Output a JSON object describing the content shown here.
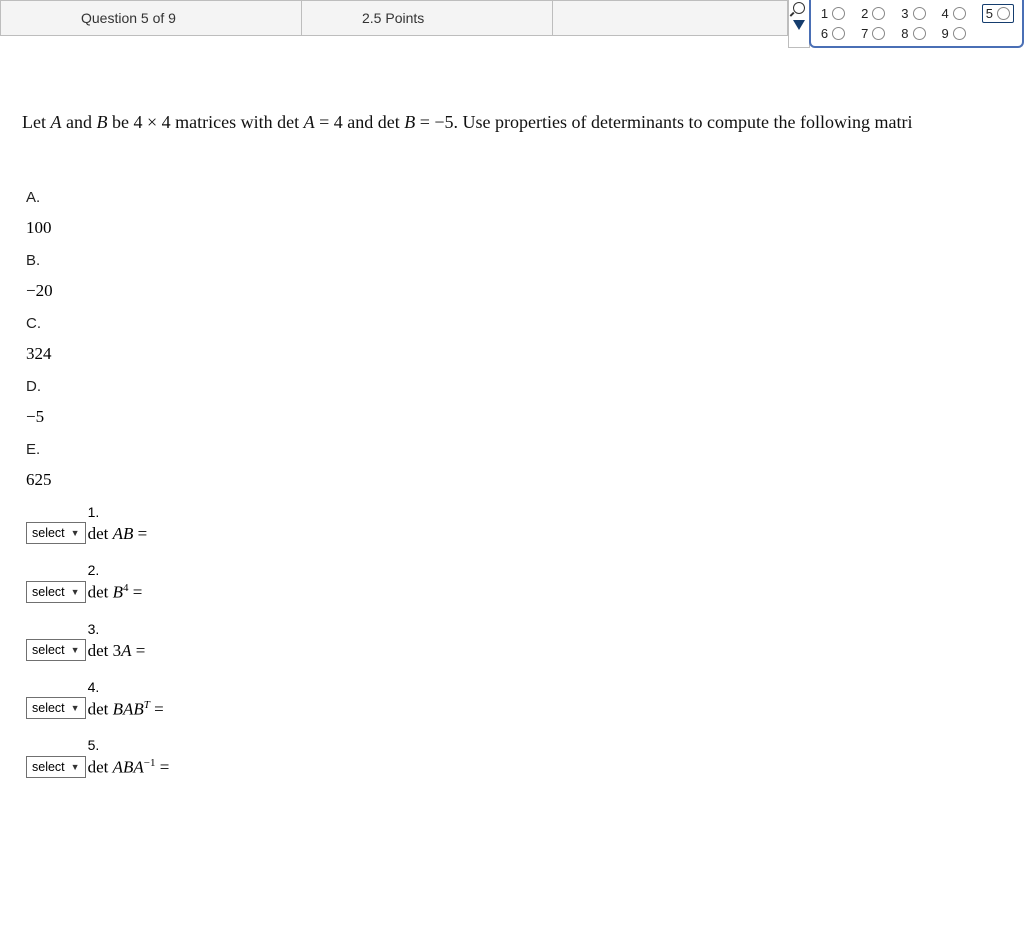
{
  "header": {
    "question_label": "Question 5 of 9",
    "points_label": "2.5 Points"
  },
  "nav": {
    "row1": [
      "1",
      "2",
      "3",
      "4",
      "5"
    ],
    "row2": [
      "6",
      "7",
      "8",
      "9"
    ],
    "selected": "5"
  },
  "prompt": {
    "p1": "Let ",
    "A": "A",
    "p2": " and ",
    "B": "B",
    "p3": " be 4 × 4 matrices with  det ",
    "A2": "A",
    "eq1": " = 4 and  det ",
    "B2": "B",
    "eq2": " = −5. Use properties of determinants to compute the following matri"
  },
  "answers": [
    {
      "label": "A.",
      "value": "100"
    },
    {
      "label": "B.",
      "value": "−20"
    },
    {
      "label": "C.",
      "value": "324"
    },
    {
      "label": "D.",
      "value": "−5"
    },
    {
      "label": "E.",
      "value": "625"
    }
  ],
  "select_text": "select",
  "matching": [
    {
      "num": "1.",
      "pre": "det ",
      "mid": "AB",
      "post": " ="
    },
    {
      "num": "2.",
      "pre": "det ",
      "mid": "B",
      "sup": "4",
      "post": " ="
    },
    {
      "num": "3.",
      "pre": "det 3",
      "mid": "A",
      "post": " ="
    },
    {
      "num": "4.",
      "pre": "det ",
      "mid": "BAB",
      "sup": "T",
      "post": " ="
    },
    {
      "num": "5.",
      "pre": "det ",
      "mid": "ABA",
      "sup": "−1",
      "post": " ="
    }
  ]
}
